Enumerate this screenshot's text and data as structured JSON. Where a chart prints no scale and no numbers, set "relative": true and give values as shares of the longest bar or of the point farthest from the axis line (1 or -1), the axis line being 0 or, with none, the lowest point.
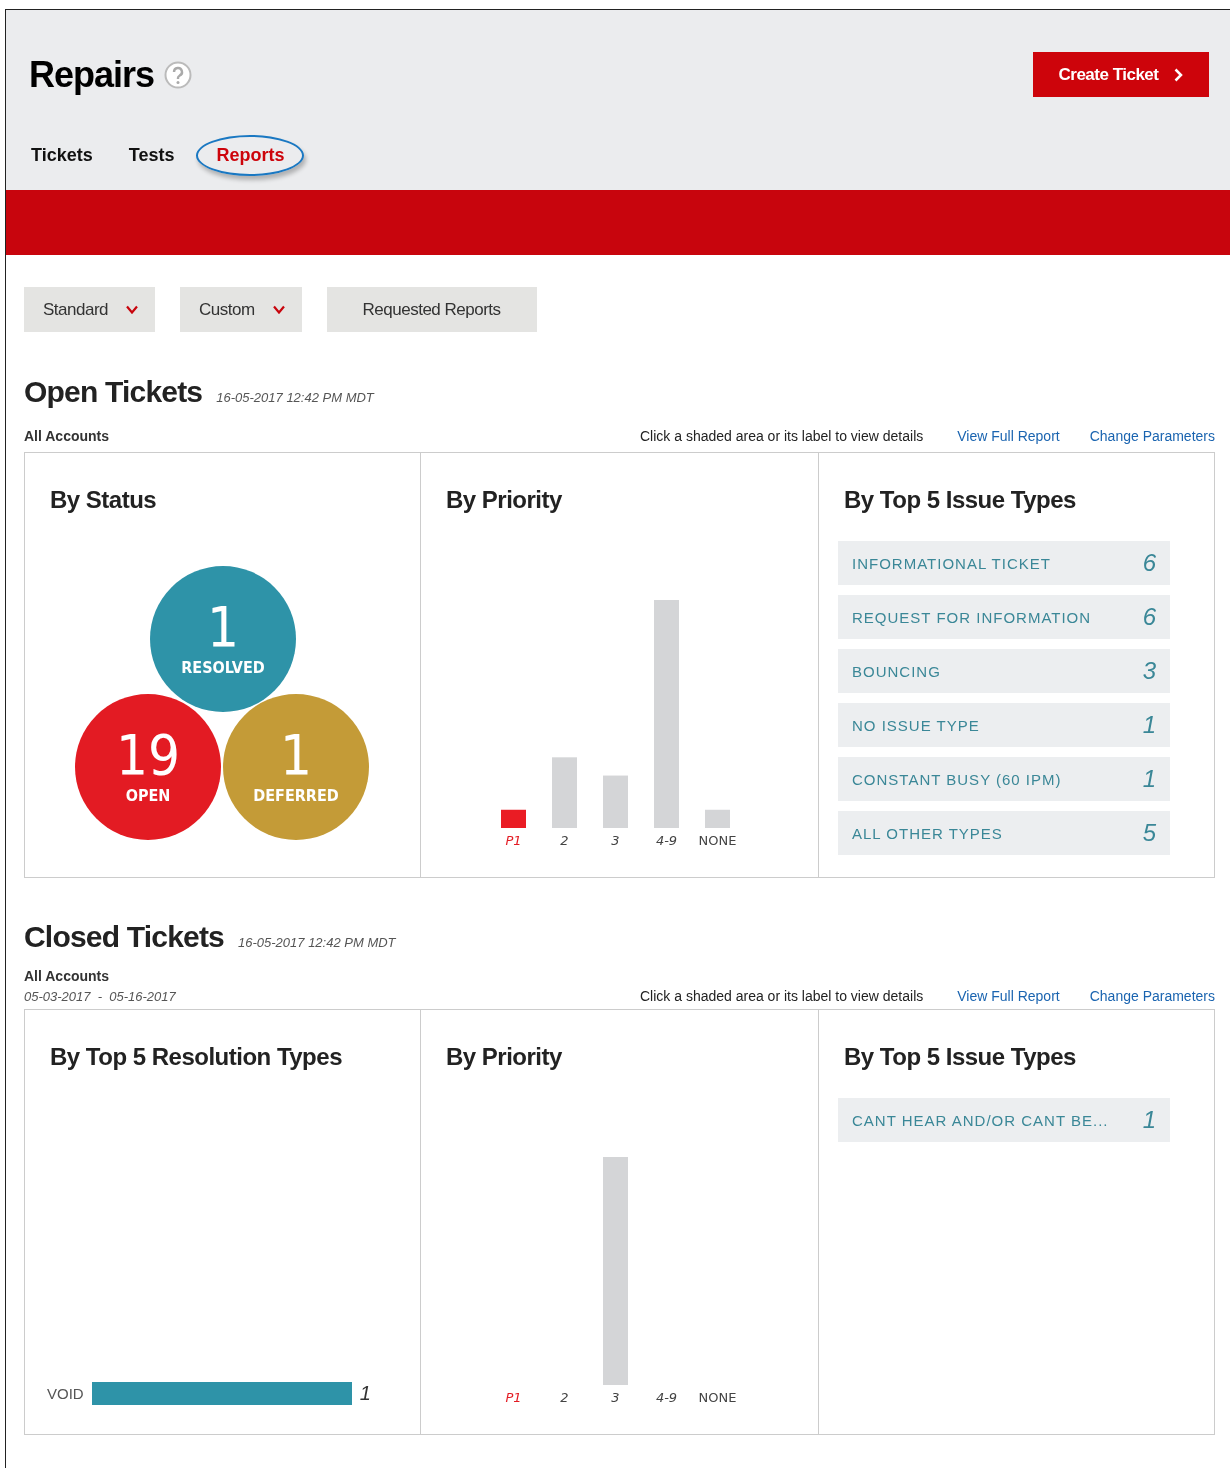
{
  "header": {
    "title": "Repairs",
    "create_button": "Create Ticket"
  },
  "tabs": [
    {
      "label": "Tickets",
      "selected": false
    },
    {
      "label": "Tests",
      "selected": false
    },
    {
      "label": "Reports",
      "selected": true
    }
  ],
  "report_menu": [
    {
      "label": "Standard",
      "kind": "dropdown"
    },
    {
      "label": "Custom",
      "kind": "dropdown"
    },
    {
      "label": "Requested Reports",
      "kind": "button"
    }
  ],
  "sections": [
    {
      "title": "Open Tickets",
      "timestamp": "16-05-2017 12:42 PM MDT",
      "scope": "All Accounts",
      "hint": "Click a shaded area or its label to view details",
      "links": [
        "View Full Report",
        "Change Parameters"
      ],
      "panels": [
        {
          "kind": "status",
          "title": "By Status",
          "statuses": [
            {
              "count": "1",
              "label": "RESOLVED",
              "color": "#2e93a8"
            },
            {
              "count": "19",
              "label": "OPEN",
              "color": "#e31b23"
            },
            {
              "count": "1",
              "label": "DEFERRED",
              "color": "#c49b37"
            }
          ]
        },
        {
          "kind": "priority",
          "title": "By Priority",
          "chart_data": {
            "type": "bar",
            "relative": true,
            "categories": [
              "P1",
              "2",
              "3",
              "4-9",
              "NONE"
            ],
            "values": [
              0.08,
              0.31,
              0.23,
              1,
              0.08
            ]
          }
        },
        {
          "kind": "issues",
          "title": "By Top 5 Issue Types",
          "items": [
            {
              "label": "INFORMATIONAL TICKET",
              "count": "6"
            },
            {
              "label": "REQUEST FOR INFORMATION",
              "count": "6"
            },
            {
              "label": "BOUNCING",
              "count": "3"
            },
            {
              "label": "NO ISSUE TYPE",
              "count": "1"
            },
            {
              "label": "CONSTANT BUSY (60 IPM)",
              "count": "1"
            },
            {
              "label": "ALL OTHER TYPES",
              "count": "5"
            }
          ]
        }
      ]
    },
    {
      "title": "Closed Tickets",
      "timestamp": "16-05-2017 12:42 PM MDT",
      "scope": "All Accounts",
      "date_range": "05-03-2017  -  05-16-2017",
      "hint": "Click a shaded area or its label to view details",
      "links": [
        "View Full Report",
        "Change Parameters"
      ],
      "panels": [
        {
          "kind": "resolution",
          "title": "By Top 5 Resolution Types",
          "items": [
            {
              "label": "VOID",
              "count": "1"
            }
          ]
        },
        {
          "kind": "priority",
          "title": "By Priority",
          "chart_data": {
            "type": "bar",
            "relative": true,
            "categories": [
              "P1",
              "2",
              "3",
              "4-9",
              "NONE"
            ],
            "values": [
              0,
              0,
              1,
              0,
              0
            ]
          }
        },
        {
          "kind": "issues",
          "title": "By Top 5 Issue Types",
          "items": [
            {
              "label": "CANT HEAR AND/OR CANT BE...",
              "count": "1"
            }
          ]
        }
      ]
    }
  ]
}
